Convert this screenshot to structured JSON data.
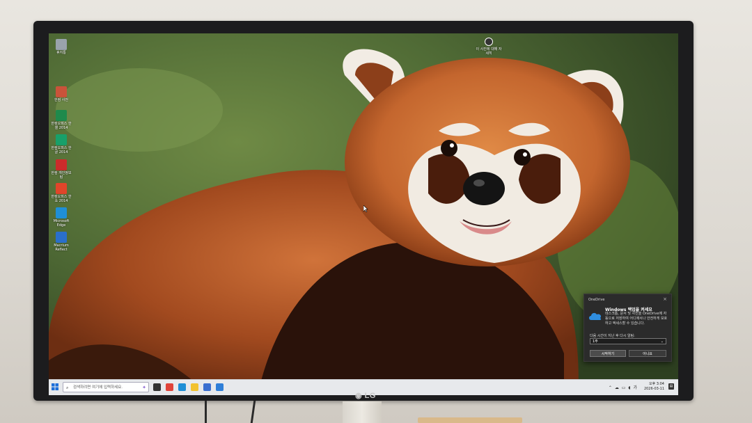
{
  "bezel": {
    "brand": "LG"
  },
  "desktop": {
    "icons": [
      {
        "label": "휴지통",
        "icon": "recycle-bin-icon",
        "color": "#9aa3ad"
      },
      {
        "label": "한컴 사전",
        "icon": "hancom-dictionary-icon",
        "color": "#c9533a"
      },
      {
        "label": "한컴오피스 한셀 2014",
        "icon": "hancell-icon",
        "color": "#1f8a4c"
      },
      {
        "label": "한컴오피스 한글 2014",
        "icon": "hangul-icon",
        "color": "#18a06a"
      },
      {
        "label": "한컴 개인정보탐",
        "icon": "hancom-privacy-icon",
        "color": "#cc2b2b"
      },
      {
        "label": "한컴오피스 한쇼 2014",
        "icon": "hanshow-icon",
        "color": "#e0452a"
      },
      {
        "label": "Microsoft Edge",
        "icon": "edge-icon",
        "color": "#1f8fd6"
      },
      {
        "label": "Macrium Reflect",
        "icon": "macrium-reflect-icon",
        "color": "#2a6fcb"
      }
    ],
    "top_tray": {
      "label": "이 사진에 대해 자세히",
      "icon": "learn-about-picture-icon"
    }
  },
  "onedrive": {
    "app_name": "OneDrive",
    "title": "Windows 백업을 켜세요",
    "body": "데스크톱, 문서 및 사진을 OneDrive에 자동으로 저장하여 어디에서나 안전하게 보호하고 액세스할 수 있습니다.",
    "remind_label": "다음 시간이 지난 후 다시 알림:",
    "remind_value": "1주",
    "primary_button": "시작하기",
    "secondary_button": "아니요"
  },
  "taskbar": {
    "search_placeholder": "검색하려면 여기에 입력하세요.",
    "apps": [
      {
        "icon": "task-view-icon",
        "color": "#333333"
      },
      {
        "icon": "chrome-icon",
        "color": "#e0443a"
      },
      {
        "icon": "edge-icon",
        "color": "#1f8fd6"
      },
      {
        "icon": "file-explorer-icon",
        "color": "#f2c230"
      },
      {
        "icon": "microsoft-store-icon",
        "color": "#3a6fd0"
      },
      {
        "icon": "mail-icon",
        "color": "#2f7fd8"
      }
    ],
    "time": "오후 3:04",
    "date": "2026-03-11"
  }
}
